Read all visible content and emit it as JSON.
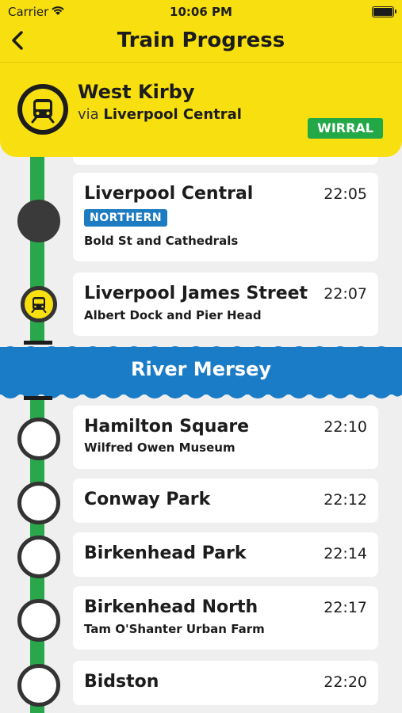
{
  "status": {
    "carrier": "Carrier",
    "time": "10:06 PM"
  },
  "nav": {
    "back": "‹",
    "title": "Train Progress"
  },
  "train": {
    "destination": "West Kirby",
    "via_label": "via",
    "via_station": "Liverpool Central",
    "line": "WIRRAL"
  },
  "river": {
    "label": "River Mersey"
  },
  "stops": [
    {
      "name": "Liverpool Central",
      "time": "22:05",
      "badge": "NORTHERN",
      "sub": "Bold St and Cathedrals"
    },
    {
      "name": "Liverpool James Street",
      "time": "22:07",
      "sub": "Albert Dock and Pier Head"
    },
    {
      "name": "Hamilton Square",
      "time": "22:10",
      "sub": "Wilfred Owen Museum"
    },
    {
      "name": "Conway Park",
      "time": "22:12"
    },
    {
      "name": "Birkenhead Park",
      "time": "22:14"
    },
    {
      "name": "Birkenhead North",
      "time": "22:17",
      "sub": "Tam O'Shanter Urban Farm"
    },
    {
      "name": "Bidston",
      "time": "22:20"
    }
  ],
  "colors": {
    "header": "#f7df10",
    "line": "#2aa64b",
    "river": "#1a7bc7",
    "northern": "#1d7bc1"
  }
}
